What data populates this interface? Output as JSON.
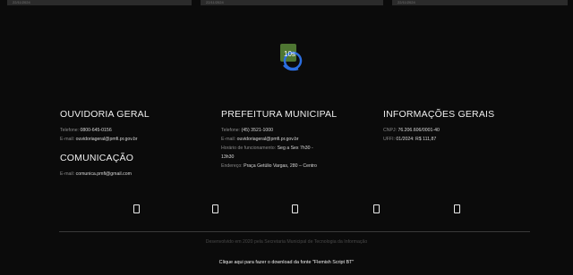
{
  "top_strip": {
    "dates": [
      "22/11/2024",
      "22/11/2024",
      "22/11/2024"
    ]
  },
  "logo": {
    "text": "10s"
  },
  "columns": {
    "ouvidoria": {
      "title": "OUVIDORIA GERAL",
      "phone_label": "Telefone:",
      "phone": "0800-645-0156",
      "email_label": "E-mail:",
      "email": "ouvidoriageral@pmfi.pr.gov.br"
    },
    "comunicacao": {
      "title": "COMUNICAÇÃO",
      "email_label": "E-mail:",
      "email": "comunica.pmfi@gmail.com"
    },
    "prefeitura": {
      "title": "PREFEITURA MUNICIPAL",
      "phone_label": "Telefone:",
      "phone": "(45) 3521-1000",
      "email_label": "E-mail:",
      "email": "ouvidoriageral@pmfi.pr.gov.br",
      "hours_label": "Horário de funcionamento:",
      "hours": "Seg a Sex 7h30 - 13h30",
      "address_label": "Endereço:",
      "address": "Praça Getúlio Vargas, 280 – Centro"
    },
    "informacoes": {
      "title": "INFORMAÇÕES GERAIS",
      "cnpj_label": "CNPJ:",
      "cnpj": "76.206.606/0001-40",
      "ufir_label": "UFFI:",
      "ufir": "01/2024: R$ 111,87"
    }
  },
  "socials": [
    "facebook-icon",
    "instagram-icon",
    "youtube-icon",
    "linkedin-icon",
    "whatsapp-icon"
  ],
  "footer": {
    "credit": "Desenvolvido em 2020 pela Secretaria Municipal de Tecnologia da Informação",
    "download": "Clique aqui para fazer o download da fonte \"Flemish Script BT\""
  }
}
